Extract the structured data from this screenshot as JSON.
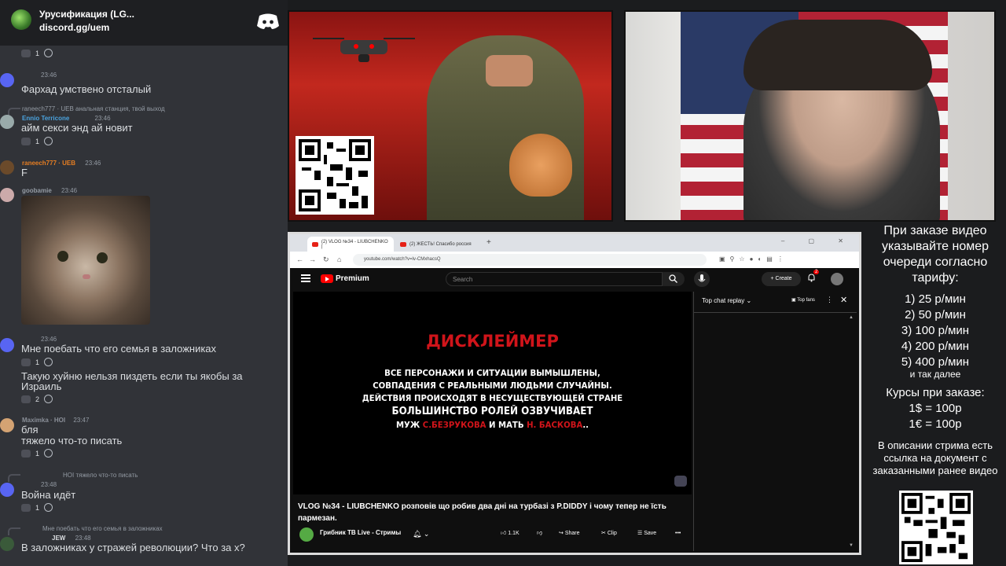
{
  "discord": {
    "server_name": "Урусификация (LG...",
    "invite": "discord.gg/uem",
    "messages": [
      {
        "nick": "",
        "time": "",
        "text": "",
        "reaction": "1"
      },
      {
        "nick": "",
        "time": "23:46",
        "text": "Фархад умствено отсталый",
        "reaction": ""
      },
      {
        "reply": "raneech777 · UEB  анальная станция, твой выход",
        "nick": "Ennio Terricone",
        "time": "23:46",
        "text": "айм секси энд ай новит",
        "reaction": "1"
      },
      {
        "nick": "raneech777 · UEB",
        "time": "23:46",
        "text": "F",
        "reaction": ""
      },
      {
        "nick": "goobamie",
        "time": "23:46",
        "text": "",
        "reaction": ""
      },
      {
        "nick": "",
        "time": "23:46",
        "text": "Мне поебать что его семья в заложниках",
        "reaction": "1"
      },
      {
        "nick": "",
        "time": "",
        "text": "Такую хуйню нельзя пиздеть если ты якобы за",
        "text2": "Израиль",
        "reaction": "2"
      },
      {
        "nick": "Maximka · HOI",
        "time": "23:47",
        "text": "бля",
        "text2": "тяжело что-то писать",
        "reaction": "1"
      },
      {
        "reply": "HOI  тяжело что-то писать",
        "nick": "",
        "time": "23:48",
        "text": "Война идёт",
        "reaction": "1"
      },
      {
        "reply": "Мне поебать что его семья в заложниках",
        "nick": "JEW",
        "time": "23:48",
        "text": "В заложниках у стражей революции? Что за х?",
        "reaction": ""
      }
    ]
  },
  "browser": {
    "tab1": "(2) VLOG №34 - LIUBCHENKO |",
    "tab2": "(2) ЖЕСТЬ! Спасибо россия",
    "url": "youtube.com/watch?v=lv-CMxhacsQ"
  },
  "youtube": {
    "brand": "Premium",
    "search_placeholder": "Search",
    "create": "Create",
    "notifications": "2",
    "disclaimer_title": "ДИСКЛЕЙМЕР",
    "disclaimer_lines": [
      "ВСЕ ПЕРСОНАЖИ И СИТУАЦИИ ВЫМЫШЛЕНЫ,",
      "СОВПАДЕНИЯ С РЕАЛЬНЫМИ ЛЮДЬМИ СЛУЧАЙНЫ.",
      "ДЕЙСТВИЯ ПРОИСХОДЯТ В НЕСУЩЕСТВУЮЩЕЙ СТРАНЕ",
      "БОЛЬШИНСТВО РОЛЕЙ ОЗВУЧИВАЕТ"
    ],
    "voice_line": {
      "a": "МУЖ ",
      "b": "С.БЕЗРУКОВА",
      "c": " И МАТЬ ",
      "d": "Н. БАСКОВА",
      "e": ".."
    },
    "video_title": "VLOG №34 - LIUBCHENKO розповів що робив два дні на турбазі з P.DIDDY і чому тепер не їсть пармезан.",
    "channel": "Грибник ТВ Live - Стримы",
    "likes": "1.1K",
    "share": "Share",
    "clip": "Clip",
    "save": "Save",
    "chat_mode": "Top chat replay",
    "top_fans": "Top fans"
  },
  "info": {
    "title": "При заказе видео указывайте номер очереди согласно тарифу:",
    "tariffs": [
      "1) 25 р/мин",
      "2) 50 р/мин",
      "3) 100 р/мин",
      "4) 200 р/мин",
      "5) 400 р/мин"
    ],
    "more": "и так далее",
    "courses_title": "Курсы при заказе:",
    "rates": [
      "1$ = 100р",
      "1€ = 100р"
    ],
    "description_note": "В описании стрима есть ссылка на документ с заказанными ранее видео"
  }
}
